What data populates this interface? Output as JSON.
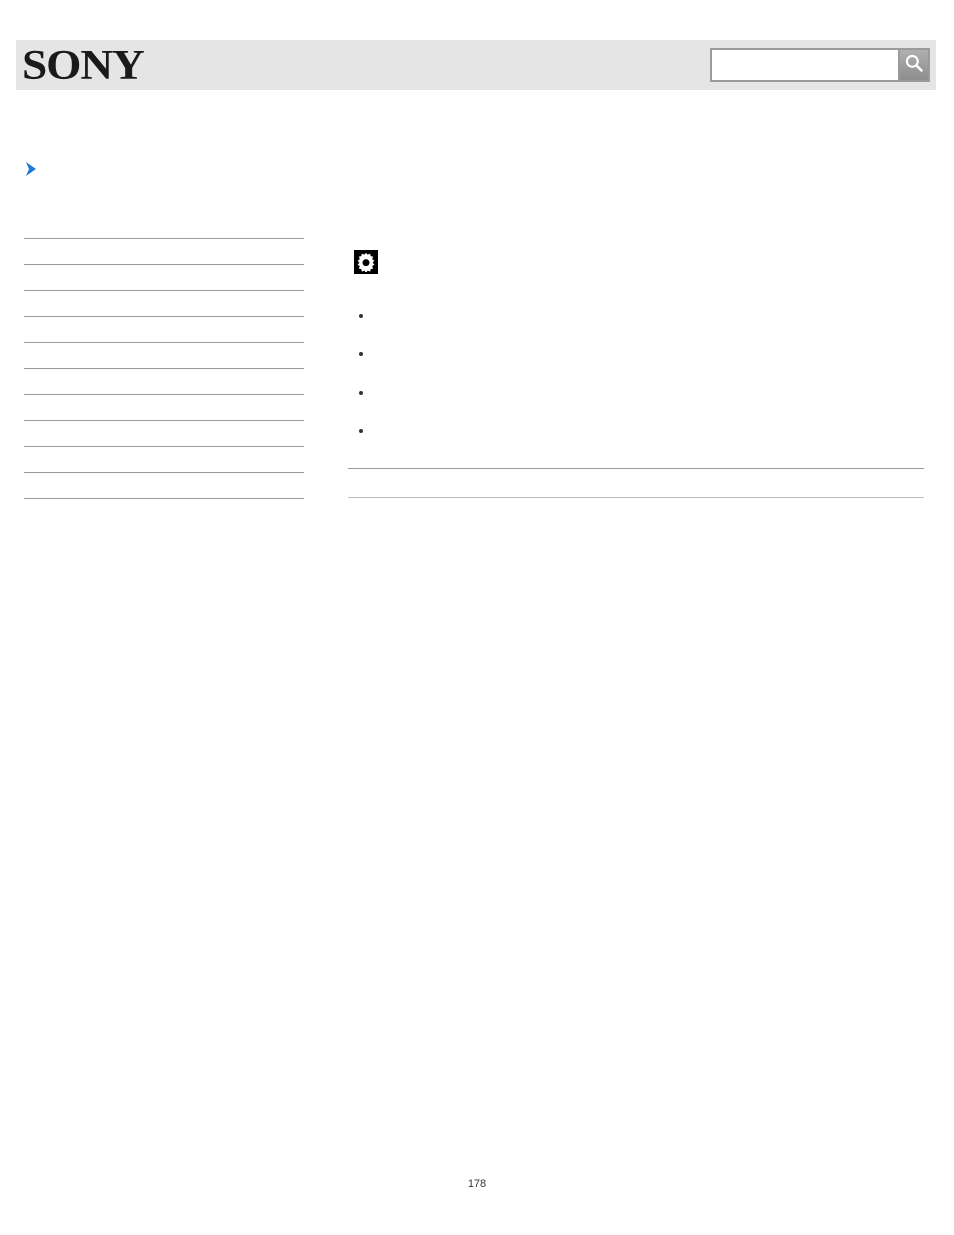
{
  "header": {
    "logo_text": "SONY",
    "search_placeholder": "",
    "search_value": ""
  },
  "breadcrumb": {
    "text": ""
  },
  "sidebar": {
    "items": [
      {
        "label": ""
      },
      {
        "label": ""
      },
      {
        "label": ""
      },
      {
        "label": ""
      },
      {
        "label": ""
      },
      {
        "label": ""
      },
      {
        "label": ""
      },
      {
        "label": ""
      },
      {
        "label": ""
      },
      {
        "label": ""
      }
    ]
  },
  "main": {
    "title": "",
    "intro_before_icon": "",
    "intro_after_icon": "",
    "intro_line2": "",
    "note_heading": "",
    "notes": [
      "",
      "",
      "",
      ""
    ],
    "back_to_top": "",
    "copyright": ""
  },
  "page_number": "178"
}
